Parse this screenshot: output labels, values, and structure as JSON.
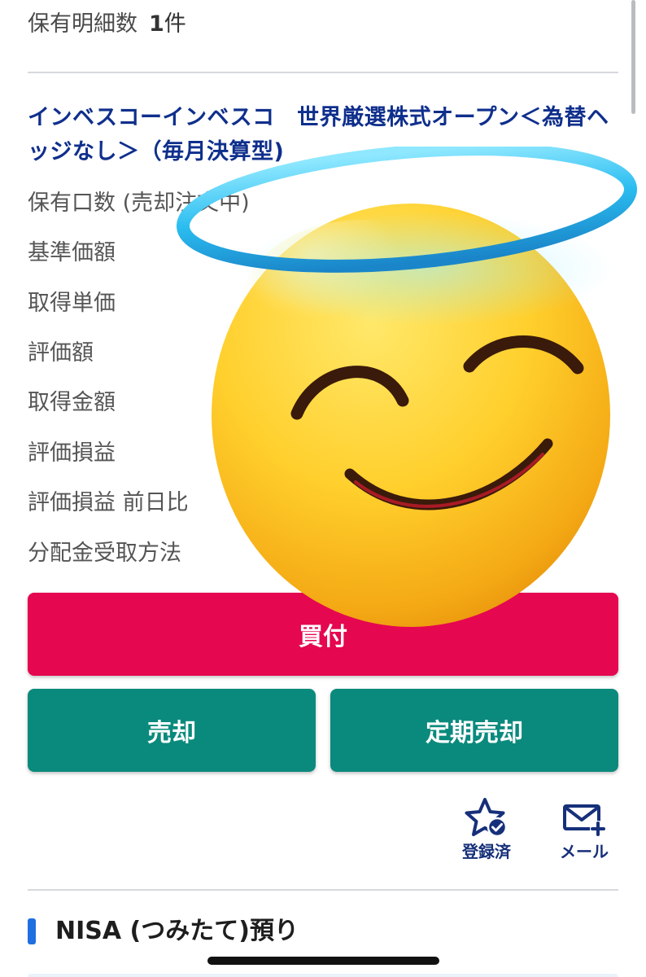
{
  "holdings": {
    "label": "保有明細数",
    "count": "1",
    "unit": "件"
  },
  "fund": {
    "name": "インベスコーインベスコ　世界厳選株式オープン＜為替ヘッジなし＞（毎月決算型)",
    "details": [
      {
        "label": "保有口数 (売却注文中)",
        "value": ""
      },
      {
        "label": "基準価額",
        "value": ""
      },
      {
        "label": "取得単価",
        "value": ""
      },
      {
        "label": "評価額",
        "value": ""
      },
      {
        "label": "取得金額",
        "value": ""
      },
      {
        "label": "評価損益",
        "value": ""
      },
      {
        "label": "評価損益 前日比",
        "value": ""
      },
      {
        "label": "分配金受取方法",
        "value": ""
      }
    ]
  },
  "buttons": {
    "buy": "買付",
    "sell": "売却",
    "periodic_sell": "定期売却"
  },
  "actions": {
    "registered_label": "登録済",
    "registered_icon": "star-check-icon",
    "mail_label": "メール",
    "mail_icon": "mail-plus-icon"
  },
  "section": {
    "title": "NISA (つみたて)預り"
  },
  "overlay": {
    "icon": "smiling-face-with-halo-emoji"
  },
  "colors": {
    "fund_name": "#0f2f8c",
    "buy_button": "#e5074f",
    "sell_button": "#0a8a7d",
    "section_accent": "#1f6fe0",
    "action_icon": "#16307a"
  }
}
